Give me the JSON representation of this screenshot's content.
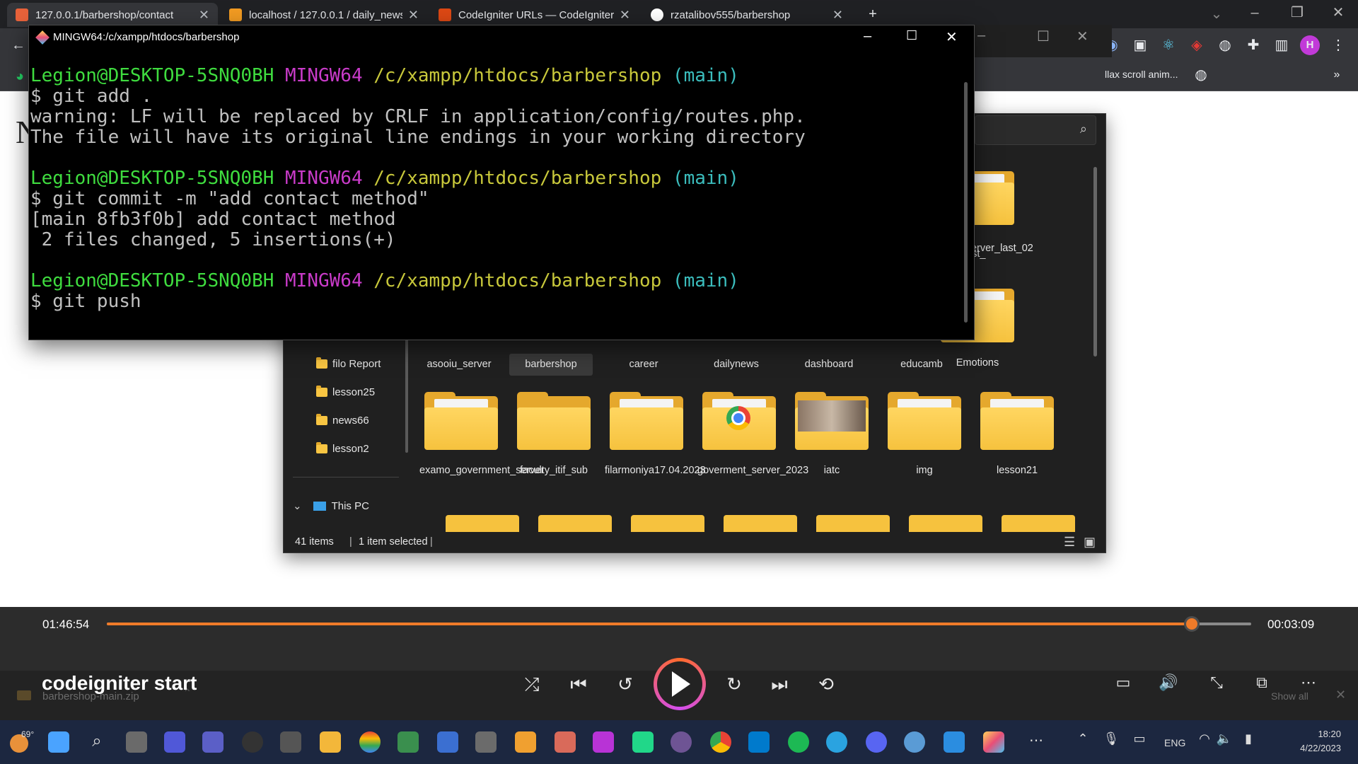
{
  "browser": {
    "tabs": [
      {
        "title": "127.0.0.1/barbershop/contact",
        "favicon_color": "#e8623a",
        "active": true
      },
      {
        "title": "localhost / 127.0.0.1 / daily_news",
        "favicon_color": "#f29b22",
        "active": false
      },
      {
        "title": "CodeIgniter URLs — CodeIgniter",
        "favicon_color": "#dd4814",
        "active": false
      },
      {
        "title": "rzatalibov555/barbershop",
        "favicon_color": "#ffffff",
        "active": false
      }
    ],
    "bookmark_text": "llax scroll anim..."
  },
  "page": {
    "letter": "N"
  },
  "terminal": {
    "title": "MINGW64:/c/xampp/htdocs/barbershop",
    "prompt": {
      "user": "Legion@DESKTOP-5SNQ0BH",
      "shell": "MINGW64",
      "path": "/c/xampp/htdocs/barbershop",
      "branch": "(main)"
    },
    "blocks": [
      {
        "command": "$ git add .",
        "output": [
          "warning: LF will be replaced by CRLF in application/config/routes.php.",
          "The file will have its original line endings in your working directory"
        ]
      },
      {
        "command": "$ git commit -m \"add contact method\"",
        "output": [
          "[main 8fb3f0b] add contact method",
          " 2 files changed, 5 insertions(+)"
        ]
      },
      {
        "command": "$ git push",
        "output": []
      }
    ]
  },
  "explorer": {
    "nav_items": [
      "filo Report",
      "lesson25",
      "news66",
      "lesson2"
    ],
    "this_pc": "This PC",
    "folders_row1": [
      "asooiu_server",
      "barbershop",
      "career",
      "dailynews",
      "dashboard",
      "educamb",
      "Emotions"
    ],
    "folders_row2": [
      "examo_government_server",
      "faculty_itif_sub",
      "filarmoniya17.04.2023",
      "goverment_server_2023",
      "iatc",
      "img",
      "lesson21"
    ],
    "top_right_folder": "asoiu_server_last_02",
    "top_partial_label": "ast_",
    "status_items": "41 items",
    "status_selected": "1 item selected"
  },
  "player": {
    "elapsed": "01:46:54",
    "remaining": "00:03:09",
    "progress_fraction": 0.948,
    "title": "codeigniter start",
    "download_name": "barbershop-main.zip",
    "show_all": "Show all",
    "accent": "#f07b29"
  },
  "taskbar": {
    "weather": "69°",
    "language": "ENG",
    "time": "18:20",
    "date": "4/22/2023"
  }
}
